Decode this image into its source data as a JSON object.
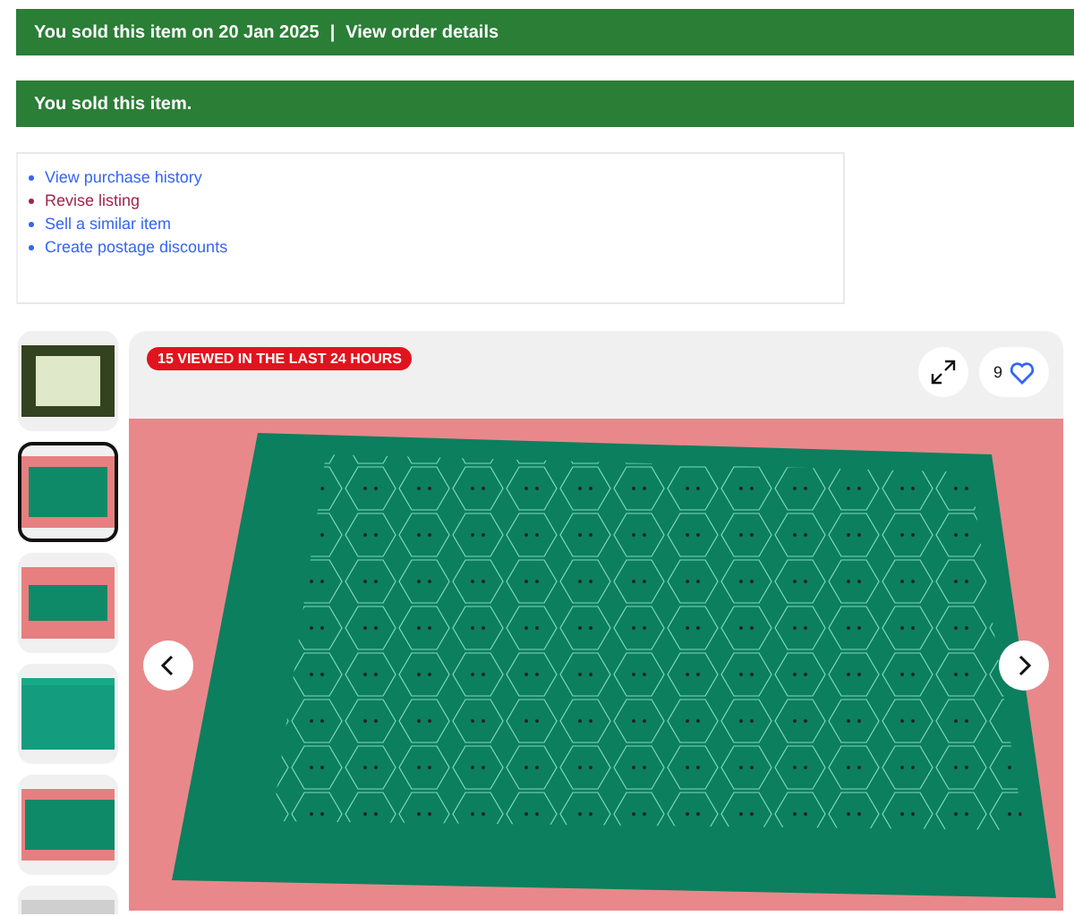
{
  "sold_banner": {
    "text": "You sold this item on 20 Jan 2025",
    "separator": "|",
    "link": "View order details"
  },
  "status_banner": {
    "text": "You sold this item."
  },
  "actions": [
    {
      "label": "View purchase history",
      "visited": false
    },
    {
      "label": "Revise listing",
      "visited": true
    },
    {
      "label": "Sell a similar item",
      "visited": false
    },
    {
      "label": "Create postage discounts",
      "visited": false
    }
  ],
  "gallery": {
    "thumbnails": [
      {
        "selected": false
      },
      {
        "selected": true
      },
      {
        "selected": false
      },
      {
        "selected": false
      },
      {
        "selected": false
      },
      {
        "selected": false
      }
    ],
    "badge": "15 VIEWED IN THE LAST 24 HOURS",
    "watch_count": "9"
  }
}
